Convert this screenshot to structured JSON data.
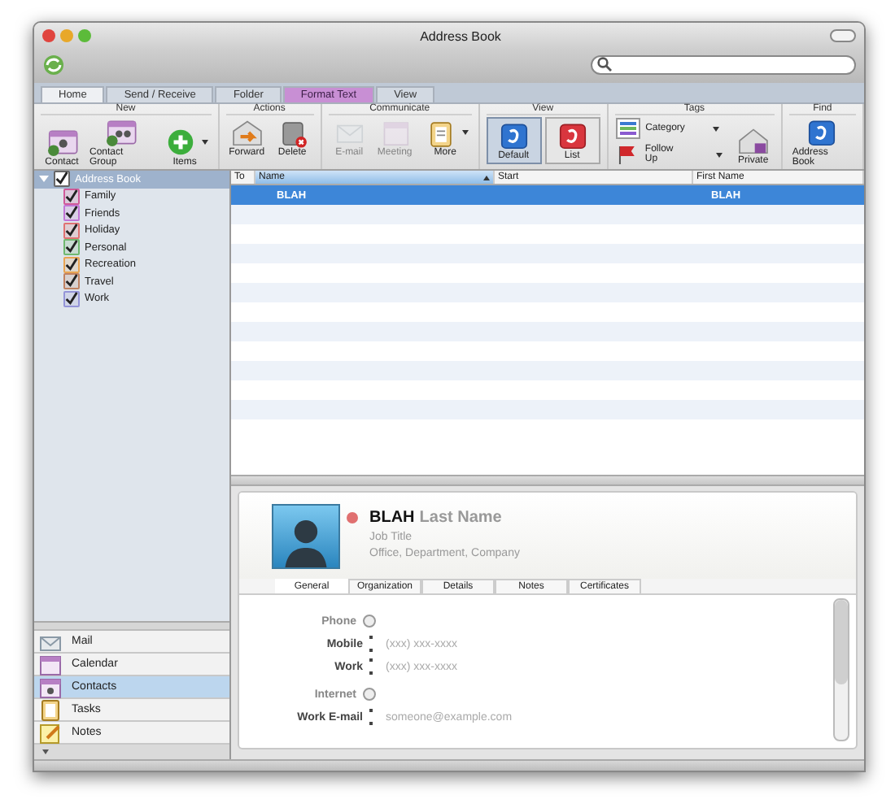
{
  "window": {
    "title": "Address Book"
  },
  "tabs": [
    {
      "label": "Home",
      "selected": true,
      "kind": "normal"
    },
    {
      "label": "Send / Receive",
      "selected": false,
      "kind": "normal"
    },
    {
      "label": "Folder",
      "selected": false,
      "kind": "normal"
    },
    {
      "label": "Format Text",
      "selected": false,
      "kind": "contextual"
    },
    {
      "label": "View",
      "selected": false,
      "kind": "normal"
    }
  ],
  "ribbon": [
    {
      "title": "New",
      "items": [
        {
          "label": "Contact",
          "disabled": false,
          "dropdown": false
        },
        {
          "label": "Contact Group",
          "disabled": false,
          "dropdown": false
        },
        {
          "label": "Items",
          "disabled": false,
          "dropdown": true
        }
      ]
    },
    {
      "title": "Actions",
      "items": [
        {
          "label": "Forward",
          "disabled": false,
          "dropdown": false
        },
        {
          "label": "Delete",
          "disabled": false,
          "dropdown": false
        }
      ]
    },
    {
      "title": "Communicate",
      "items": [
        {
          "label": "E-mail",
          "disabled": true,
          "dropdown": false
        },
        {
          "label": "Meeting",
          "disabled": true,
          "dropdown": false
        },
        {
          "label": "More",
          "disabled": false,
          "dropdown": true
        }
      ]
    },
    {
      "title": "View",
      "items": [
        {
          "label": "Default",
          "disabled": false,
          "dropdown": false,
          "selected": true
        },
        {
          "label": "List",
          "disabled": false,
          "dropdown": false,
          "selected": false
        }
      ]
    },
    {
      "title": "Tags",
      "items": [
        {
          "label": "Category",
          "kind": "small",
          "disabled": false,
          "dropdown": true
        },
        {
          "label": "Follow Up",
          "kind": "small",
          "disabled": false,
          "dropdown": true
        },
        {
          "label": "Private",
          "kind": "large",
          "disabled": false,
          "dropdown": false
        }
      ]
    },
    {
      "title": "Find",
      "items": [
        {
          "label": "Address Book",
          "disabled": false,
          "dropdown": false
        }
      ]
    }
  ],
  "sidebar": {
    "items": [
      {
        "label": "Address Book",
        "checked": true,
        "expanded": true,
        "selected": true,
        "children": [
          {
            "label": "Family",
            "checked": true,
            "color": "#d05a9a"
          },
          {
            "label": "Friends",
            "checked": true,
            "color": "#c276d6"
          },
          {
            "label": "Holiday",
            "checked": true,
            "color": "#e07272"
          },
          {
            "label": "Personal",
            "checked": true,
            "color": "#6fb86f"
          },
          {
            "label": "Recreation",
            "checked": true,
            "color": "#e8a452"
          },
          {
            "label": "Travel",
            "checked": true,
            "color": "#c08262"
          },
          {
            "label": "Work",
            "checked": true,
            "color": "#9494d8"
          }
        ]
      }
    ]
  },
  "table": {
    "columns": [
      {
        "label": "To",
        "sorted": false
      },
      {
        "label": "Name",
        "sorted": true
      },
      {
        "label": "Start",
        "sorted": false
      },
      {
        "label": "First Name",
        "sorted": false
      }
    ],
    "rows": [
      {
        "name": "BLAH",
        "first_name": "BLAH",
        "selected": true
      }
    ]
  },
  "contact": {
    "first_name": "BLAH",
    "last_name": "Last Name",
    "job_title": "Job Title",
    "organization": "Office, Department, Company",
    "tabs": [
      {
        "label": "General",
        "selected": true
      },
      {
        "label": "Organization",
        "selected": false
      },
      {
        "label": "Details",
        "selected": false
      },
      {
        "label": "Notes",
        "selected": false
      },
      {
        "label": "Certificates",
        "selected": false
      }
    ],
    "sections": [
      {
        "title": "Phone",
        "fields": [
          {
            "label": "Mobile",
            "placeholder": "(xxx) xxx-xxxx"
          },
          {
            "label": "Work",
            "placeholder": "(xxx) xxx-xxxx"
          }
        ]
      },
      {
        "title": "Internet",
        "fields": [
          {
            "label": "Work E-mail",
            "placeholder": "someone@example.com"
          }
        ]
      }
    ]
  },
  "nav": [
    {
      "label": "Mail",
      "selected": false
    },
    {
      "label": "Calendar",
      "selected": false
    },
    {
      "label": "Contacts",
      "selected": true
    },
    {
      "label": "Tasks",
      "selected": false
    },
    {
      "label": "Notes",
      "selected": false
    }
  ]
}
